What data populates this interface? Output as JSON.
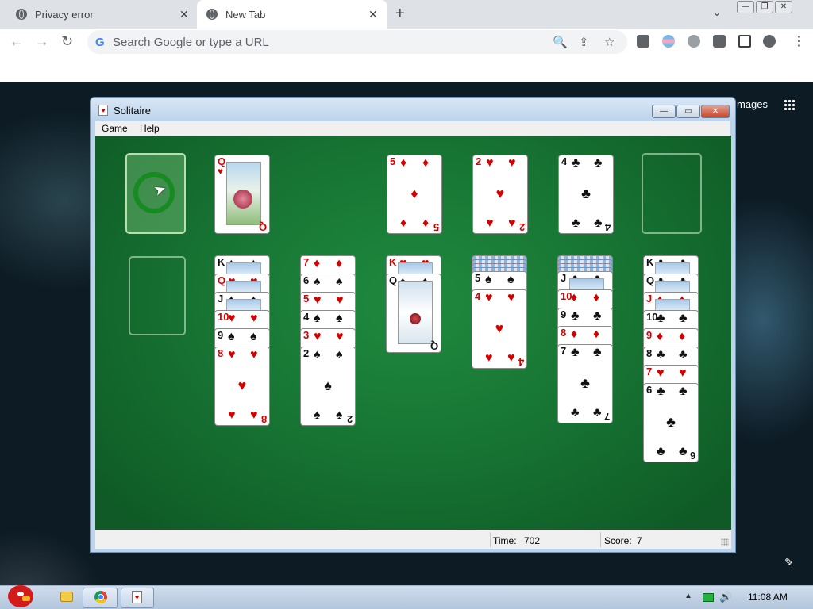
{
  "browser": {
    "tabs": [
      {
        "title": "Privacy error",
        "close": "✕"
      },
      {
        "title": "New Tab",
        "close": "✕"
      }
    ],
    "new_tab_symbol": "+",
    "tab_search_symbol": "⌄",
    "window_buttons": {
      "minimize": "—",
      "restore": "❐",
      "close": "✕"
    },
    "nav": {
      "back": "←",
      "forward": "→",
      "reload": "↻"
    },
    "omnibox": {
      "google_glyph": "G",
      "placeholder": "Search Google or type a URL"
    },
    "omnibox_icons": {
      "zoom": "🔍",
      "share": "⇪",
      "bookmark": "☆"
    },
    "toolbar_icons": [
      "ublock-shield-icon",
      "extension-icon",
      "profile-icon"
    ],
    "menu_symbol": "⋮",
    "colors": {
      "tabbar": "#dee1e6",
      "omnibox": "#f1f3f4"
    }
  },
  "newtab_page": {
    "images_link": "mages",
    "edit_symbol": "✎"
  },
  "solitaire": {
    "title": "Solitaire",
    "icon_glyph": "♥",
    "controls": {
      "minimize": "—",
      "maximize": "▭",
      "close": "✕"
    },
    "menu": [
      "Game",
      "Help"
    ],
    "status": {
      "time_label": "Time:",
      "time_value": "702",
      "score_label": "Score:",
      "score_value": "7"
    },
    "felt_color": "#167232",
    "waste_card": {
      "rank": "Q",
      "suit": "♥"
    },
    "foundations": [
      {
        "rank": "5",
        "suit": "♦"
      },
      {
        "rank": "2",
        "suit": "♥"
      },
      {
        "rank": "4",
        "suit": "♣"
      },
      {
        "rank": "",
        "suit": ""
      }
    ],
    "tableau": [
      {
        "hidden": 0,
        "cards": []
      },
      {
        "hidden": 0,
        "cards": [
          {
            "rank": "K",
            "suit": "♠"
          },
          {
            "rank": "Q",
            "suit": "♥"
          },
          {
            "rank": "J",
            "suit": "♠"
          },
          {
            "rank": "10",
            "suit": "♥"
          },
          {
            "rank": "9",
            "suit": "♠"
          },
          {
            "rank": "8",
            "suit": "♥"
          }
        ]
      },
      {
        "hidden": 0,
        "cards": [
          {
            "rank": "7",
            "suit": "♦"
          },
          {
            "rank": "6",
            "suit": "♠"
          },
          {
            "rank": "5",
            "suit": "♥"
          },
          {
            "rank": "4",
            "suit": "♠"
          },
          {
            "rank": "3",
            "suit": "♥"
          },
          {
            "rank": "2",
            "suit": "♠"
          }
        ]
      },
      {
        "hidden": 0,
        "cards": [
          {
            "rank": "K",
            "suit": "♥"
          },
          {
            "rank": "Q",
            "suit": "♠"
          }
        ]
      },
      {
        "hidden": 4,
        "cards": [
          {
            "rank": "5",
            "suit": "♠"
          },
          {
            "rank": "4",
            "suit": "♥"
          }
        ]
      },
      {
        "hidden": 4,
        "cards": [
          {
            "rank": "J",
            "suit": "♣"
          },
          {
            "rank": "10",
            "suit": "♦"
          },
          {
            "rank": "9",
            "suit": "♣"
          },
          {
            "rank": "8",
            "suit": "♦"
          },
          {
            "rank": "7",
            "suit": "♣"
          }
        ]
      },
      {
        "hidden": 0,
        "cards": [
          {
            "rank": "K",
            "suit": "♣"
          },
          {
            "rank": "Q",
            "suit": "♣"
          },
          {
            "rank": "J",
            "suit": "♦"
          },
          {
            "rank": "10",
            "suit": "♣"
          },
          {
            "rank": "9",
            "suit": "♦"
          },
          {
            "rank": "8",
            "suit": "♣"
          },
          {
            "rank": "7",
            "suit": "♥"
          },
          {
            "rank": "6",
            "suit": "♣"
          }
        ]
      }
    ]
  },
  "taskbar": {
    "clock": "11:08 AM",
    "tray_up": "▲",
    "volume": "🔊",
    "items": [
      "angry-birds-start-icon",
      "folder-icon",
      "chrome-icon",
      "solitaire-icon"
    ]
  }
}
